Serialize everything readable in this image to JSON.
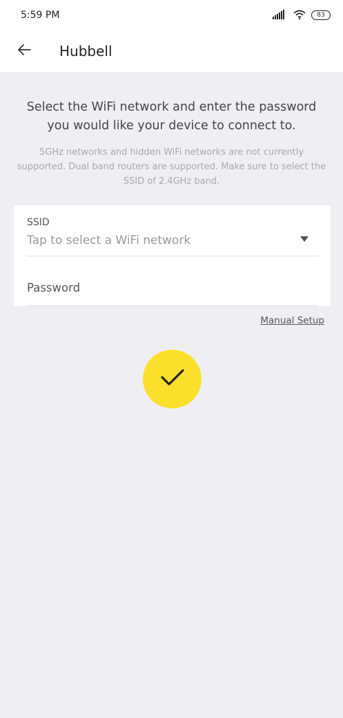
{
  "status_bar": {
    "time": "5:59 PM",
    "battery": "83",
    "icons": [
      "signal-icon",
      "wifi-icon",
      "battery-icon"
    ]
  },
  "header": {
    "title": "Hubbell",
    "back_icon": "back-arrow-icon"
  },
  "intro": {
    "title": "Select the WiFi network and enter the password you would like your device to connect to.",
    "note": "5GHz networks and hidden WiFi networks are not currently supported. Dual band routers are supported. Make sure to select the SSID of 2.4GHz band."
  },
  "form": {
    "ssid_label": "SSID",
    "ssid_placeholder": "Tap to select a WiFi network",
    "password_placeholder": "Password"
  },
  "manual_setup": "Manual Setup",
  "confirm_icon": "check-icon",
  "colors": {
    "background": "#efeef3",
    "accent": "#fbe02b"
  }
}
